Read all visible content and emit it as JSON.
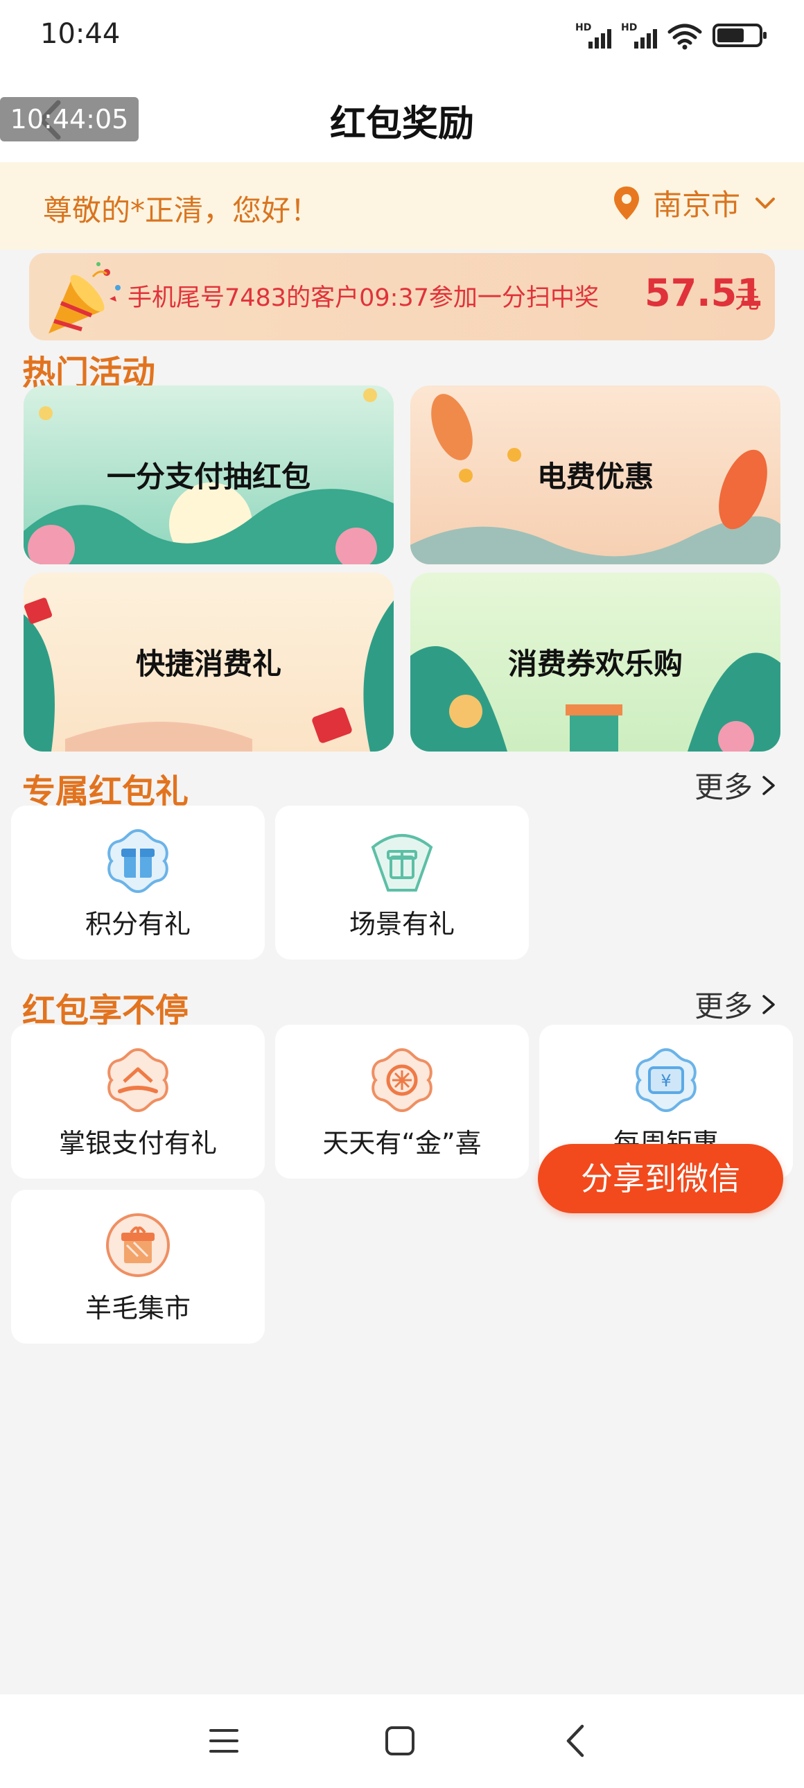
{
  "status_bar": {
    "time": "10:44",
    "signal1_badge": "HD",
    "signal2_badge": "HD"
  },
  "overlay_time": "10:44:05",
  "header": {
    "title": "红包奖励"
  },
  "greeting": {
    "text": "尊敬的*正清，您好！",
    "city": "南京市"
  },
  "winner_banner": {
    "text": "手机尾号7483的客户09:37参加一分扫中奖",
    "amount": "57.51",
    "unit": "元"
  },
  "hot_activities": {
    "title": "热门活动",
    "items": [
      {
        "label": "一分支付抽红包"
      },
      {
        "label": "电费优惠"
      },
      {
        "label": "快捷消费礼"
      },
      {
        "label": "消费券欢乐购"
      }
    ]
  },
  "exclusive": {
    "title": "专属红包礼",
    "more": "更多",
    "items": [
      {
        "label": "积分有礼",
        "icon": "gift-icon"
      },
      {
        "label": "场景有礼",
        "icon": "gift-box-icon"
      }
    ]
  },
  "nonstop": {
    "title": "红包享不停",
    "more": "更多",
    "items": [
      {
        "label": "掌银支付有礼",
        "icon": "house-hand-icon"
      },
      {
        "label": "天天有“金”喜",
        "icon": "sun-coin-icon"
      },
      {
        "label": "每周钜惠",
        "icon": "yen-ticket-icon"
      },
      {
        "label": "羊毛集市",
        "icon": "gift-icon"
      }
    ]
  },
  "share_button": "分享到微信",
  "colors": {
    "accent": "#e2731e",
    "red": "#e0323a",
    "share": "#f24a1d",
    "greeting_bg": "#fdf5e2"
  }
}
